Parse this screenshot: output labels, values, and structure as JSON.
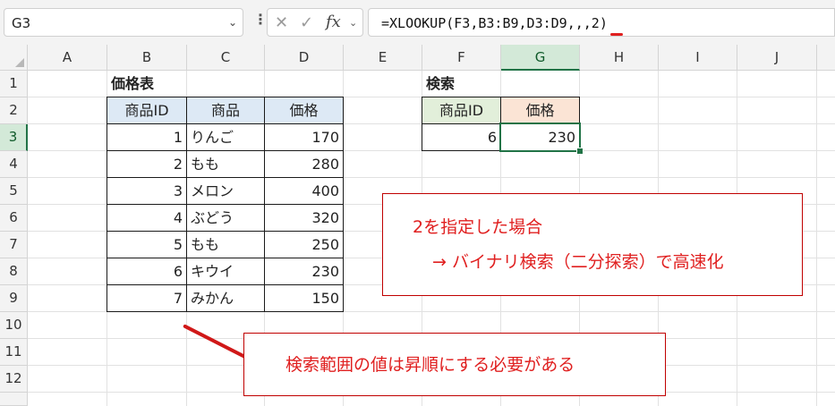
{
  "formula_bar": {
    "name_box": "G3",
    "formula": "=XLOOKUP(F3,B3:B9,D3:D9,,,2)",
    "cancel_symbol": "✕",
    "enter_symbol": "✓",
    "fx_label": "fx"
  },
  "columns": [
    "A",
    "B",
    "C",
    "D",
    "E",
    "F",
    "G",
    "H",
    "I",
    "J"
  ],
  "rows": [
    "1",
    "2",
    "3",
    "4",
    "5",
    "6",
    "7",
    "8",
    "9",
    "10",
    "11",
    "12"
  ],
  "selected_cell": "G3",
  "price_table": {
    "title": "価格表",
    "headers": [
      "商品ID",
      "商品",
      "価格"
    ],
    "rows": [
      {
        "id": "1",
        "name": "りんご",
        "price": "170"
      },
      {
        "id": "2",
        "name": "もも",
        "price": "280"
      },
      {
        "id": "3",
        "name": "メロン",
        "price": "400"
      },
      {
        "id": "4",
        "name": "ぶどう",
        "price": "320"
      },
      {
        "id": "5",
        "name": "もも",
        "price": "250"
      },
      {
        "id": "6",
        "name": "キウイ",
        "price": "230"
      },
      {
        "id": "7",
        "name": "みかん",
        "price": "150"
      }
    ]
  },
  "search": {
    "title": "検索",
    "id_header": "商品ID",
    "price_header": "価格",
    "id_value": "6",
    "price_value": "230"
  },
  "callouts": {
    "binary_search_line1": "2を指定した場合",
    "binary_search_line2": "→ バイナリ検索（二分探索）で高速化",
    "ascending_note": "検索範囲の値は昇順にする必要がある"
  },
  "colors": {
    "accent_green": "#217346",
    "callout_red": "#e02020",
    "header_blue": "#dde9f5",
    "header_green": "#e2efda",
    "header_orange": "#fbe4d5"
  }
}
